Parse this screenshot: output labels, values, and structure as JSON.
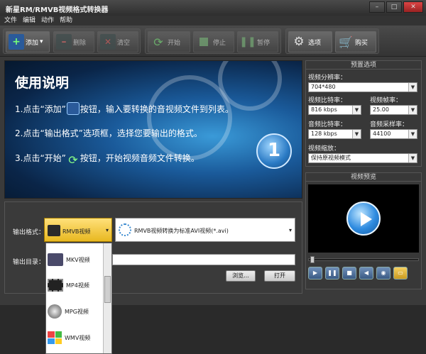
{
  "window": {
    "title": "新星RM/RMVB视频格式转换器"
  },
  "menu": [
    "文件",
    "编辑",
    "动作",
    "帮助"
  ],
  "toolbar": {
    "add": "添加",
    "delete": "删除",
    "clear": "清空",
    "start": "开始",
    "stop": "停止",
    "pause": "暂停",
    "options": "选项",
    "buy": "购买"
  },
  "banner": {
    "heading": "使用说明",
    "step1_a": "1.点击“添加”",
    "step1_b": "按钮，输入要转换的音视频文件到列表。",
    "step2": "2.点击“输出格式”选项框，选择您要输出的格式。",
    "step3_a": "3.点击“开始”",
    "step3_b": "按钮，开始视频音频文件转换。",
    "step_badge": "1"
  },
  "preset": {
    "title": "预置选项",
    "resolution_label": "视频分辨率：",
    "resolution": "704*480",
    "vbitrate_label": "视频比特率：",
    "vbitrate": "816 kbps",
    "fps_label": "视频帧率：",
    "fps": "25.00",
    "abitrate_label": "音频比特率：",
    "abitrate": "128 kbps",
    "samplerate_label": "音频采样率：",
    "samplerate": "44100",
    "scale_label": "视频缩放：",
    "scale": "保持原视频模式"
  },
  "preview": {
    "title": "视频预览"
  },
  "output": {
    "format_label": "输出格式：",
    "format_value": "RMVB视频",
    "format_desc": "RMVB视频转换为标准AVI视频(*.avi)",
    "dir_label": "输出目录：",
    "dir_value": "",
    "browse": "浏览...",
    "open": "打开"
  },
  "dropdown_items": [
    "MKV视频",
    "MP4视频",
    "MPG视频",
    "WMV视频"
  ],
  "colors": {
    "accent": "#e8b820",
    "banner": "#1a5a9a"
  }
}
